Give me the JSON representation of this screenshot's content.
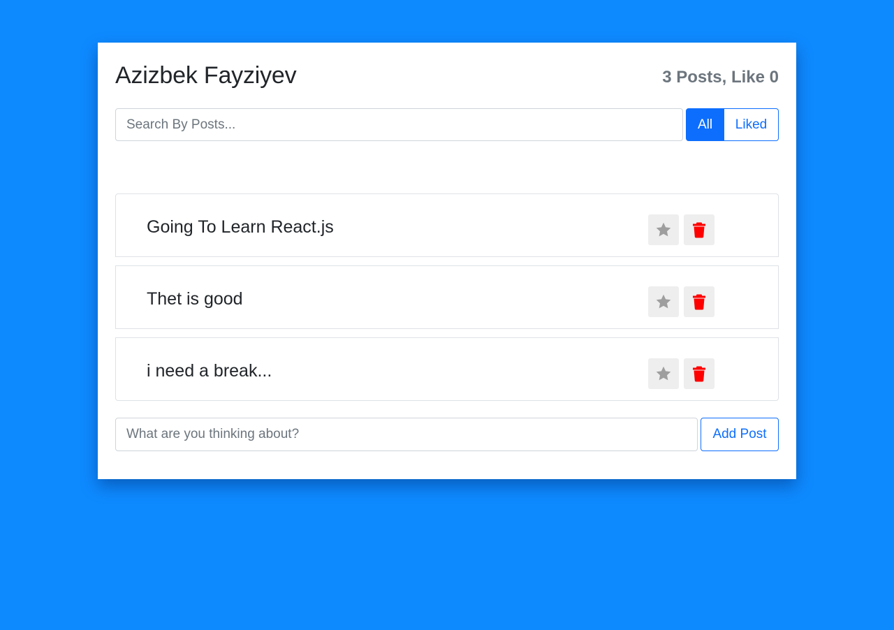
{
  "header": {
    "title": "Azizbek Fayziyev",
    "stats": "3 Posts, Like 0"
  },
  "search": {
    "placeholder": "Search By Posts...",
    "value": ""
  },
  "filters": [
    {
      "label": "All",
      "active": true
    },
    {
      "label": "Liked",
      "active": false
    }
  ],
  "posts": [
    {
      "text": "Going To Learn React.js",
      "liked": false
    },
    {
      "text": "Thet is good",
      "liked": false
    },
    {
      "text": "i need a break...",
      "liked": false
    }
  ],
  "add_post": {
    "placeholder": "What are you thinking about?",
    "value": "",
    "button_label": "Add Post"
  },
  "icons": {
    "like": "star-icon",
    "delete": "trash-icon"
  },
  "colors": {
    "background": "#0e8aff",
    "primary": "#0d6efd",
    "delete": "#ff0000",
    "star_inactive": "#9e9e9e"
  }
}
